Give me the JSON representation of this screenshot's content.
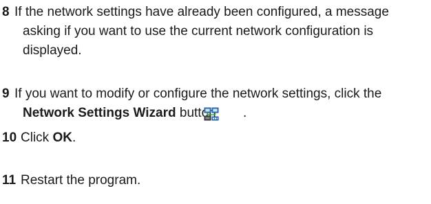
{
  "steps": [
    {
      "number": "8",
      "text": "If the network settings have already been configured, a message asking if you want to use the current network configuration is displayed."
    },
    {
      "number": "9",
      "text_before": "If you want to modify or configure the network settings, click the",
      "bold": "Network Settings Wizard",
      "text_after": "button",
      "end": ".",
      "icon": "network-settings-wizard-icon"
    },
    {
      "number": "10",
      "text_before": "Click",
      "bold": "OK",
      "end": "."
    },
    {
      "number": "11",
      "text": "Restart the program."
    }
  ],
  "colors": {
    "text": "#1a1a1a",
    "icon_blue": "#3a7fc1",
    "icon_green": "#3d9b3d"
  }
}
